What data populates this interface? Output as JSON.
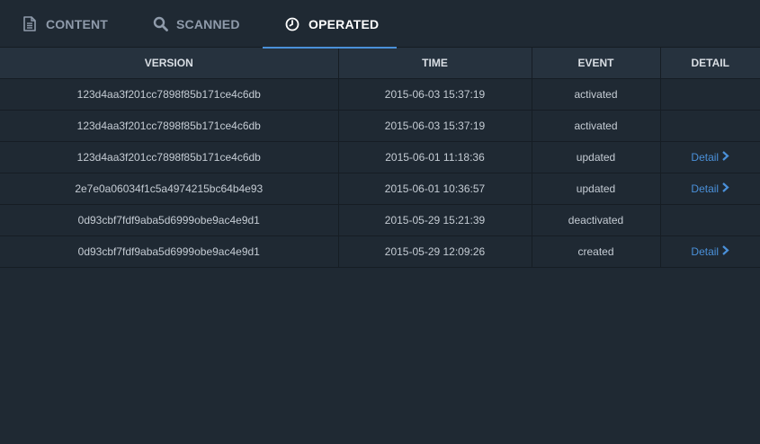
{
  "tabs": [
    {
      "label": "CONTENT",
      "icon": "document-icon",
      "active": false
    },
    {
      "label": "SCANNED",
      "icon": "search-icon",
      "active": false
    },
    {
      "label": "OPERATED",
      "icon": "clock-icon",
      "active": true
    }
  ],
  "table": {
    "headers": {
      "version": "VERSION",
      "time": "TIME",
      "event": "EVENT",
      "detail": "DETAIL"
    },
    "rows": [
      {
        "version": "123d4aa3f201cc7898f85b171ce4c6db",
        "time": "2015-06-03 15:37:19",
        "event": "activated",
        "detail": ""
      },
      {
        "version": "123d4aa3f201cc7898f85b171ce4c6db",
        "time": "2015-06-03 15:37:19",
        "event": "activated",
        "detail": ""
      },
      {
        "version": "123d4aa3f201cc7898f85b171ce4c6db",
        "time": "2015-06-01 11:18:36",
        "event": "updated",
        "detail": "Detail"
      },
      {
        "version": "2e7e0a06034f1c5a4974215bc64b4e93",
        "time": "2015-06-01 10:36:57",
        "event": "updated",
        "detail": "Detail"
      },
      {
        "version": "0d93cbf7fdf9aba5d6999obe9ac4e9d1",
        "time": "2015-05-29 15:21:39",
        "event": "deactivated",
        "detail": ""
      },
      {
        "version": "0d93cbf7fdf9aba5d6999obe9ac4e9d1",
        "time": "2015-05-29 12:09:26",
        "event": "created",
        "detail": "Detail"
      }
    ]
  },
  "colors": {
    "background": "#1f2933",
    "header_bg": "#26323e",
    "accent": "#4a90d9",
    "text": "#c5ccd4",
    "tab_inactive": "#8f9bab"
  }
}
